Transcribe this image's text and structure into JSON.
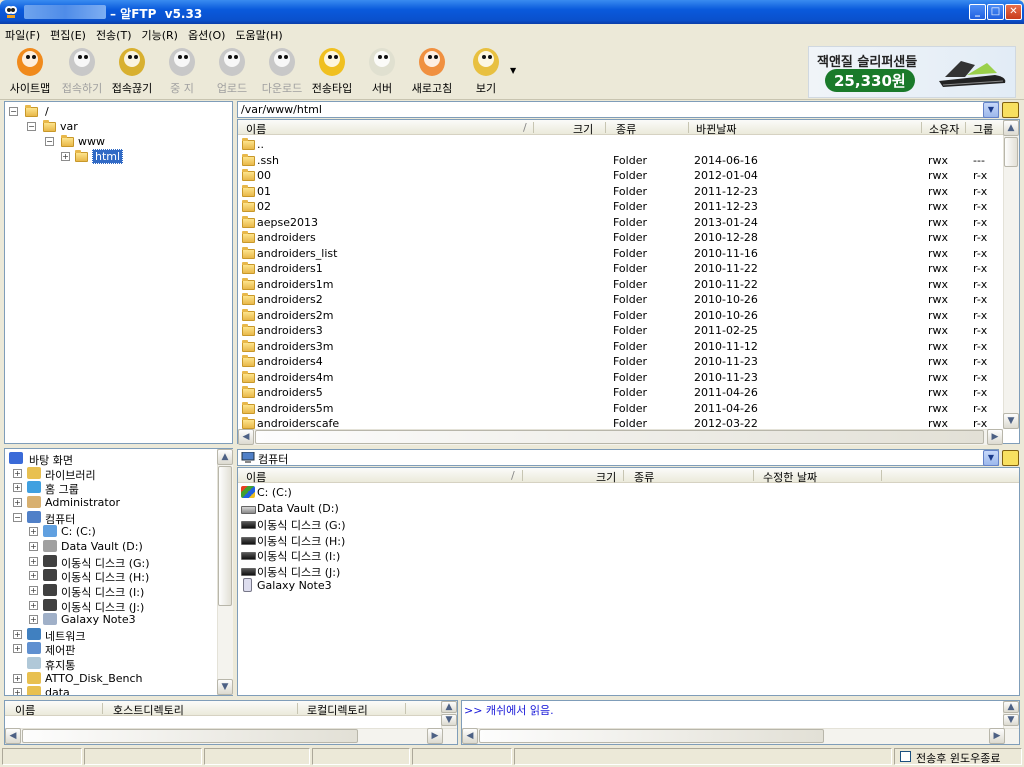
{
  "window": {
    "title": "– 알FTP  v5.33"
  },
  "menu": [
    "파일(F)",
    "편집(E)",
    "전송(T)",
    "기능(R)",
    "옵션(O)",
    "도움말(H)"
  ],
  "toolbar": [
    {
      "label": "사이트맵",
      "enabled": true,
      "color": "#f08a1c",
      "icon": "sitemap-icon"
    },
    {
      "label": "접속하기",
      "enabled": false,
      "color": "#c0c0c0",
      "icon": "connect-icon"
    },
    {
      "label": "접속끊기",
      "enabled": true,
      "color": "#d8b030",
      "icon": "disconnect-icon"
    },
    {
      "label": "중 지",
      "enabled": false,
      "color": "#c0c0c0",
      "icon": "stop-icon"
    },
    {
      "label": "업로드",
      "enabled": false,
      "color": "#c0c0c0",
      "icon": "upload-icon"
    },
    {
      "label": "다운로드",
      "enabled": false,
      "color": "#c0c0c0",
      "icon": "download-icon"
    },
    {
      "label": "전송타입",
      "enabled": true,
      "color": "#f0c020",
      "icon": "transfer-type-icon"
    },
    {
      "label": "서버",
      "enabled": true,
      "color": "#e0e0d0",
      "icon": "server-icon"
    },
    {
      "label": "새로고침",
      "enabled": true,
      "color": "#f09040",
      "icon": "refresh-icon"
    },
    {
      "label": "보기",
      "enabled": true,
      "color": "#e8c040",
      "icon": "view-icon"
    }
  ],
  "ad": {
    "title": "잭앤질 슬리퍼샌들",
    "price": "25,330원"
  },
  "remote_tree": {
    "nodes": [
      "/",
      "var",
      "www",
      "html"
    ]
  },
  "remote": {
    "path": "/var/www/html",
    "columns": [
      "이름",
      "크기",
      "종류",
      "바뀐날짜",
      "소유자",
      "그룹"
    ],
    "rows": [
      [
        "..",
        "",
        "",
        "",
        "",
        ""
      ],
      [
        ".ssh",
        "",
        "Folder",
        "2014-06-16",
        "rwx",
        "---"
      ],
      [
        "00",
        "",
        "Folder",
        "2012-01-04",
        "rwx",
        "r-x"
      ],
      [
        "01",
        "",
        "Folder",
        "2011-12-23",
        "rwx",
        "r-x"
      ],
      [
        "02",
        "",
        "Folder",
        "2011-12-23",
        "rwx",
        "r-x"
      ],
      [
        "aepse2013",
        "",
        "Folder",
        "2013-01-24",
        "rwx",
        "r-x"
      ],
      [
        "androiders",
        "",
        "Folder",
        "2010-12-28",
        "rwx",
        "r-x"
      ],
      [
        "androiders_list",
        "",
        "Folder",
        "2010-11-16",
        "rwx",
        "r-x"
      ],
      [
        "androiders1",
        "",
        "Folder",
        "2010-11-22",
        "rwx",
        "r-x"
      ],
      [
        "androiders1m",
        "",
        "Folder",
        "2010-11-22",
        "rwx",
        "r-x"
      ],
      [
        "androiders2",
        "",
        "Folder",
        "2010-10-26",
        "rwx",
        "r-x"
      ],
      [
        "androiders2m",
        "",
        "Folder",
        "2010-10-26",
        "rwx",
        "r-x"
      ],
      [
        "androiders3",
        "",
        "Folder",
        "2011-02-25",
        "rwx",
        "r-x"
      ],
      [
        "androiders3m",
        "",
        "Folder",
        "2010-11-12",
        "rwx",
        "r-x"
      ],
      [
        "androiders4",
        "",
        "Folder",
        "2010-11-23",
        "rwx",
        "r-x"
      ],
      [
        "androiders4m",
        "",
        "Folder",
        "2010-11-23",
        "rwx",
        "r-x"
      ],
      [
        "androiders5",
        "",
        "Folder",
        "2011-04-26",
        "rwx",
        "r-x"
      ],
      [
        "androiders5m",
        "",
        "Folder",
        "2011-04-26",
        "rwx",
        "r-x"
      ],
      [
        "androiderscafe",
        "",
        "Folder",
        "2012-03-22",
        "rwx",
        "r-x"
      ]
    ]
  },
  "local_tree": [
    {
      "label": "바탕 화면",
      "level": 0,
      "pm": "",
      "icon": "desktop-icon",
      "color": "#3a6ad8"
    },
    {
      "label": "라이브러리",
      "level": 1,
      "pm": "+",
      "icon": "library-icon",
      "color": "#e8c050"
    },
    {
      "label": "홈 그룹",
      "level": 1,
      "pm": "+",
      "icon": "homegroup-icon",
      "color": "#40a0e0"
    },
    {
      "label": "Administrator",
      "level": 1,
      "pm": "+",
      "icon": "user-icon",
      "color": "#d8b070"
    },
    {
      "label": "컴퓨터",
      "level": 1,
      "pm": "−",
      "icon": "computer-icon",
      "color": "#5080c8"
    },
    {
      "label": "C: (C:)",
      "level": 2,
      "pm": "+",
      "icon": "system-drive-icon",
      "color": "#60a0e0"
    },
    {
      "label": "Data Vault (D:)",
      "level": 2,
      "pm": "+",
      "icon": "drive-icon",
      "color": "#a0a0a0"
    },
    {
      "label": "이동식 디스크 (G:)",
      "level": 2,
      "pm": "+",
      "icon": "removable-drive-icon",
      "color": "#404040"
    },
    {
      "label": "이동식 디스크 (H:)",
      "level": 2,
      "pm": "+",
      "icon": "removable-drive-icon",
      "color": "#404040"
    },
    {
      "label": "이동식 디스크 (I:)",
      "level": 2,
      "pm": "+",
      "icon": "removable-drive-icon",
      "color": "#404040"
    },
    {
      "label": "이동식 디스크 (J:)",
      "level": 2,
      "pm": "+",
      "icon": "removable-drive-icon",
      "color": "#404040"
    },
    {
      "label": "Galaxy Note3",
      "level": 2,
      "pm": "+",
      "icon": "phone-icon",
      "color": "#a0b0c8"
    },
    {
      "label": "네트워크",
      "level": 1,
      "pm": "+",
      "icon": "network-icon",
      "color": "#4080c0"
    },
    {
      "label": "제어판",
      "level": 1,
      "pm": "+",
      "icon": "control-panel-icon",
      "color": "#6090d0"
    },
    {
      "label": "휴지통",
      "level": 1,
      "pm": "",
      "icon": "recycle-bin-icon",
      "color": "#b0c8d8"
    },
    {
      "label": "ATTO_Disk_Bench",
      "level": 1,
      "pm": "+",
      "icon": "folder-icon",
      "color": "#e8c050"
    },
    {
      "label": "data",
      "level": 1,
      "pm": "+",
      "icon": "folder-icon",
      "color": "#e8c050"
    }
  ],
  "local": {
    "path": "컴퓨터",
    "columns": [
      "이름",
      "크기",
      "종류",
      "수정한 날짜"
    ],
    "rows": [
      {
        "name": "C: (C:)",
        "icon": "system-drive-icon"
      },
      {
        "name": "Data Vault (D:)",
        "icon": "drive-icon"
      },
      {
        "name": "이동식 디스크 (G:)",
        "icon": "removable-drive-icon"
      },
      {
        "name": "이동식 디스크 (H:)",
        "icon": "removable-drive-icon"
      },
      {
        "name": "이동식 디스크 (I:)",
        "icon": "removable-drive-icon"
      },
      {
        "name": "이동식 디스크 (J:)",
        "icon": "removable-drive-icon"
      },
      {
        "name": "Galaxy Note3",
        "icon": "phone-icon"
      }
    ]
  },
  "queue": {
    "columns": [
      "이름",
      "호스트디렉토리",
      "로컬디렉토리"
    ]
  },
  "log": {
    "lines": [
      ">> 캐쉬에서 읽음."
    ]
  },
  "status": {
    "checkbox_label": "전송후 윈도우종료",
    "checked": false
  }
}
